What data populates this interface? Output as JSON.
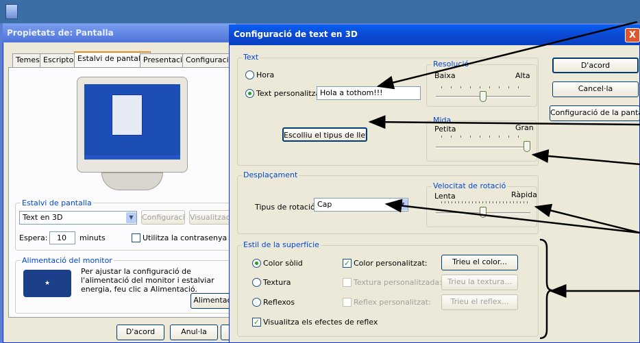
{
  "prop": {
    "title": "Propietats de: Pantalla",
    "tabs": [
      "Temes",
      "Escriptori",
      "Estalvi de pantalla",
      "Presentació",
      "Configuració"
    ],
    "screensaver_group": "Estalvi de pantalla",
    "screensaver_value": "Text en 3D",
    "config_btn": "Configuració",
    "preview_btn": "Visualització",
    "wait_label": "Espera:",
    "wait_value": "10",
    "minutes": "minuts",
    "password_chk": "Utilitza la contrasenya en rep",
    "power_group": "Alimentació del monitor",
    "power_text": "Per ajustar la configuració de l'alimentació del monitor i estalviar energia, feu clic a Alimentació.",
    "power_btn": "Alimentac",
    "ok": "D'acord",
    "cancel": "Anul·la"
  },
  "dlg": {
    "title": "Configuració de text en 3D",
    "close": "X",
    "ok": "D'acord",
    "cancel": "Cancel·la",
    "display_btn": "Configuració de la pantalla...",
    "text_group": "Text",
    "radio_time": "Hora",
    "radio_custom": "Text personalitzat:",
    "custom_text": "Hola a tothom!!!",
    "font_btn": "Escolliu el tipus de lletra...",
    "res_group": "Resolució",
    "res_low": "Baixa",
    "res_high": "Alta",
    "size_group": "Mida",
    "size_small": "Petita",
    "size_big": "Gran",
    "move_group": "Desplaçament",
    "rot_type_label": "Tipus de rotació:",
    "rot_type_value": "Cap",
    "speed_group": "Velocitat de rotació",
    "speed_slow": "Lenta",
    "speed_fast": "Ràpida",
    "surface_group": "Estil de la superfície",
    "solid": "Color sòlid",
    "texture": "Textura",
    "reflex": "Reflexos",
    "custom_color": "Color personalitzat:",
    "custom_texture": "Textura personalitzada:",
    "custom_reflex": "Reflex personalitzat:",
    "choose_color": "Trieu el color...",
    "choose_texture": "Trieu la textura...",
    "choose_reflex": "Trieu el reflex...",
    "show_reflex": "Visualitza els efectes de reflex"
  },
  "controls": {
    "resolution_level": 0.5,
    "size_level": 1.0,
    "speed_level": 0.5
  }
}
